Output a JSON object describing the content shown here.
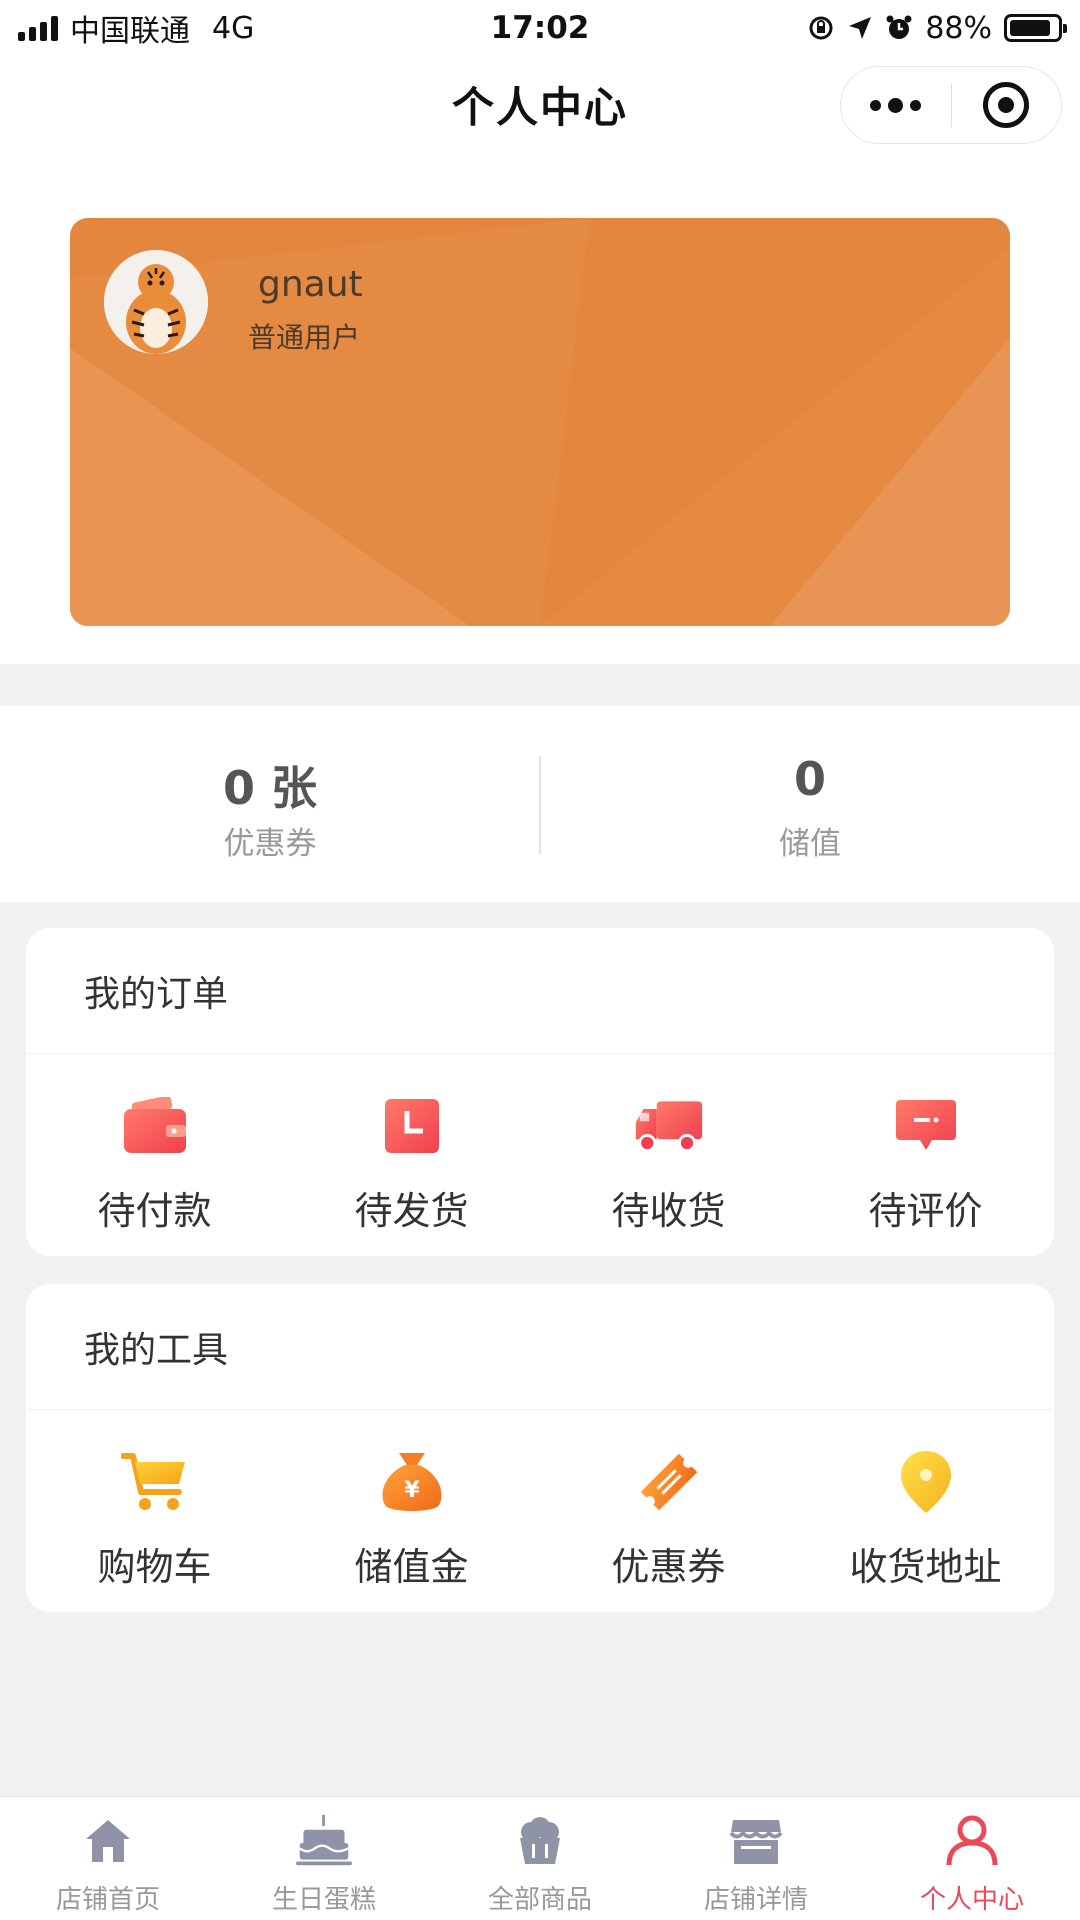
{
  "status_bar": {
    "carrier": "中国联通",
    "network": "4G",
    "time": "17:02",
    "battery_percent": "88%",
    "battery_level": 0.88
  },
  "nav": {
    "title": "个人中心"
  },
  "profile": {
    "username": "gnaut",
    "level": "普通用户",
    "card_color": "#e68a42"
  },
  "stats": {
    "coupons": {
      "value": "0 张",
      "label": "优惠券"
    },
    "balance": {
      "value": "0",
      "label": "储值"
    }
  },
  "orders": {
    "title": "我的订单",
    "items": [
      {
        "label": "待付款",
        "icon": "wallet-icon"
      },
      {
        "label": "待发货",
        "icon": "package-icon"
      },
      {
        "label": "待收货",
        "icon": "truck-icon"
      },
      {
        "label": "待评价",
        "icon": "comment-icon"
      }
    ]
  },
  "tools": {
    "title": "我的工具",
    "items": [
      {
        "label": "购物车",
        "icon": "cart-icon"
      },
      {
        "label": "储值金",
        "icon": "money-bag-icon"
      },
      {
        "label": "优惠券",
        "icon": "ticket-icon"
      },
      {
        "label": "收货地址",
        "icon": "location-pin-icon"
      }
    ]
  },
  "tab_bar": {
    "items": [
      {
        "label": "店铺首页",
        "icon": "home-icon"
      },
      {
        "label": "生日蛋糕",
        "icon": "cake-icon"
      },
      {
        "label": "全部商品",
        "icon": "basket-icon"
      },
      {
        "label": "店铺详情",
        "icon": "store-icon"
      },
      {
        "label": "个人中心",
        "icon": "user-icon"
      }
    ],
    "active_index": 4,
    "active_color": "#e94a5a",
    "inactive_icon_color": "#8e93a8"
  }
}
